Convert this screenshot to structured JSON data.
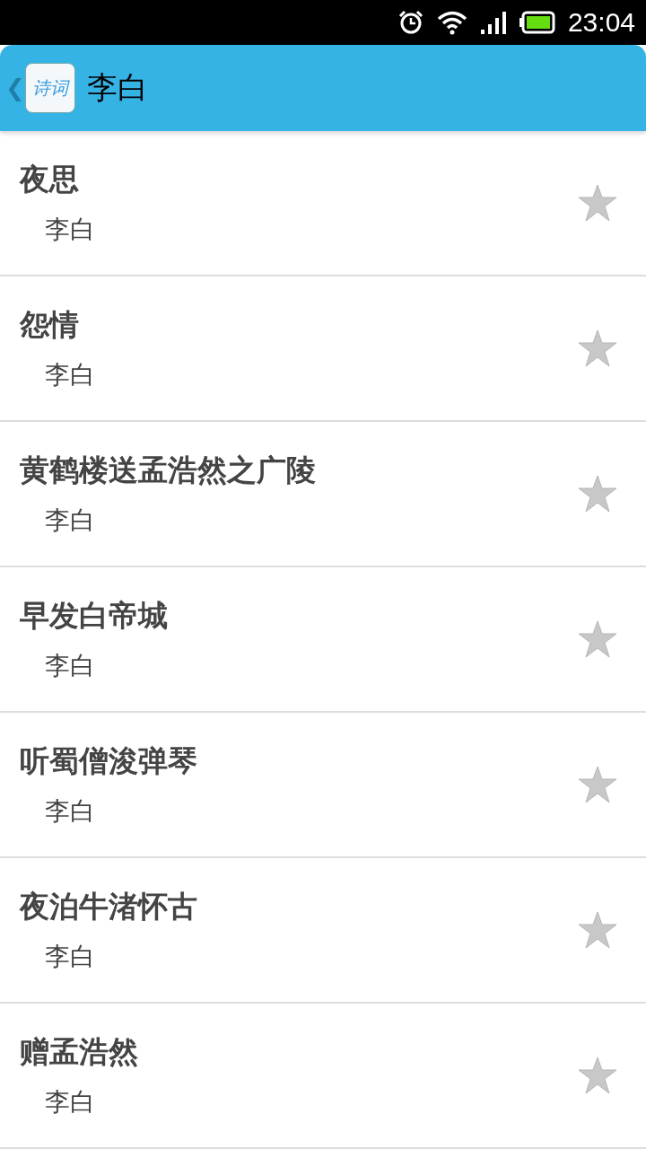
{
  "status_bar": {
    "time": "23:04"
  },
  "header": {
    "back": "❮",
    "logo_text": "诗词",
    "title": "李白"
  },
  "poems": [
    {
      "title": "夜思",
      "author": "李白",
      "favorite": false
    },
    {
      "title": "怨情",
      "author": "李白",
      "favorite": false
    },
    {
      "title": "黄鹤楼送孟浩然之广陵",
      "author": "李白",
      "favorite": false
    },
    {
      "title": "早发白帝城",
      "author": "李白",
      "favorite": false
    },
    {
      "title": "听蜀僧浚弹琴",
      "author": "李白",
      "favorite": false
    },
    {
      "title": "夜泊牛渚怀古",
      "author": "李白",
      "favorite": false
    },
    {
      "title": "赠孟浩然",
      "author": "李白",
      "favorite": false
    }
  ]
}
